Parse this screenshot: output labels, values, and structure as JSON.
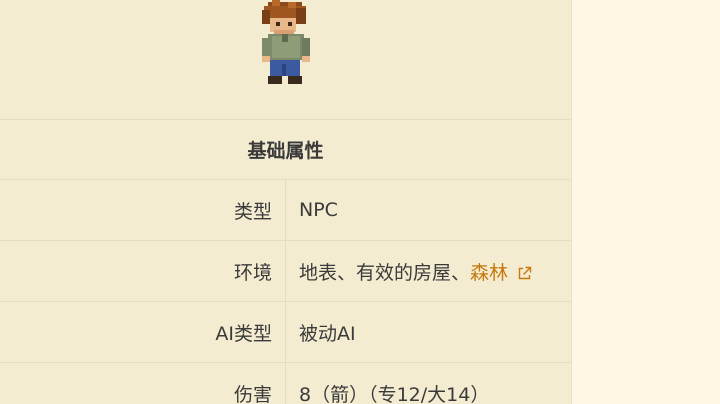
{
  "infobox": {
    "sprite_icon": "guide-npc-pixel-sprite",
    "section_title": "基础属性",
    "rows": [
      {
        "label": "类型",
        "value": "NPC"
      },
      {
        "label": "环境",
        "value_prefix": "地表、有效的房屋、",
        "link_text": "森林",
        "link_icon": "external-link-icon"
      },
      {
        "label": "AI类型",
        "value": "被动AI"
      },
      {
        "label": "伤害",
        "value": "8（箭）（专12/大14）"
      }
    ]
  },
  "colors": {
    "page_background": "#fdf7e4",
    "infobox_background": "#f4ecd1",
    "link": "#c7780f",
    "text": "#3a3a3a"
  }
}
